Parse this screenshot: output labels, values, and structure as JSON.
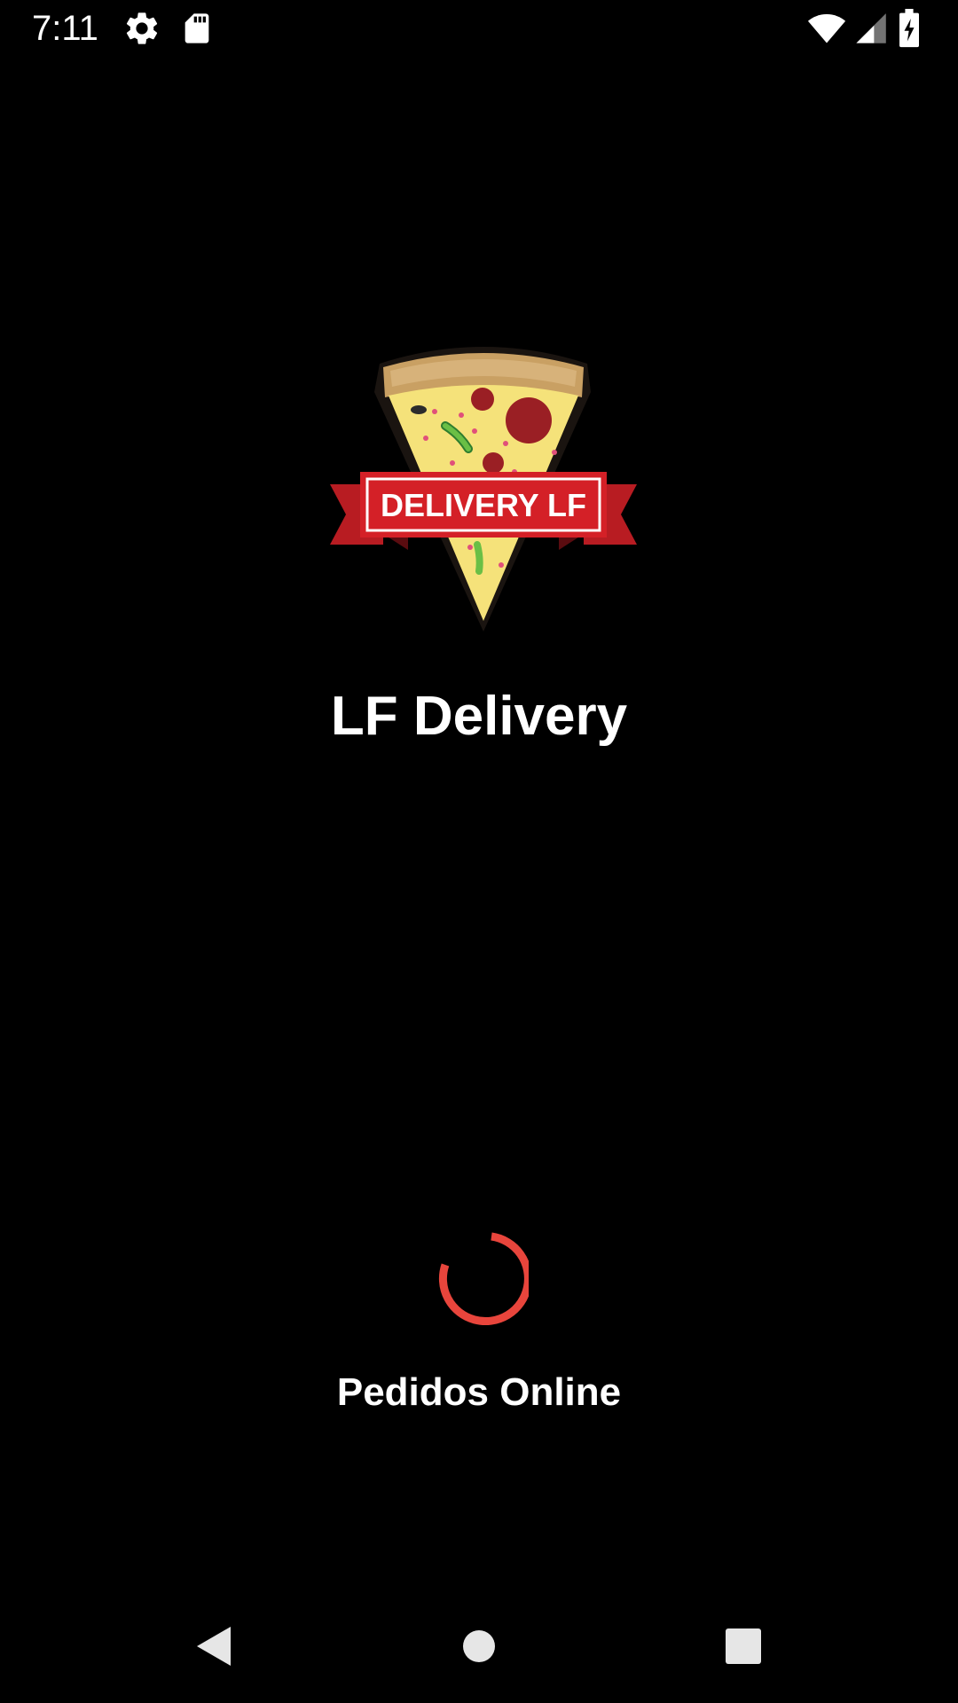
{
  "status_bar": {
    "time": "7:11",
    "icons": [
      "settings-icon",
      "sd-card-icon",
      "wifi-icon",
      "signal-icon",
      "battery-charging-icon"
    ]
  },
  "splash": {
    "logo_text": "DELIVERY LF",
    "app_title": "LF Delivery",
    "subtitle": "Pedidos Online",
    "spinner_color": "#e8453c"
  },
  "nav_bar": {
    "buttons": [
      "back-icon",
      "home-icon",
      "recents-icon"
    ]
  },
  "colors": {
    "background": "#000000",
    "text": "#ffffff",
    "accent": "#e8453c",
    "ribbon_red": "#d42027"
  }
}
